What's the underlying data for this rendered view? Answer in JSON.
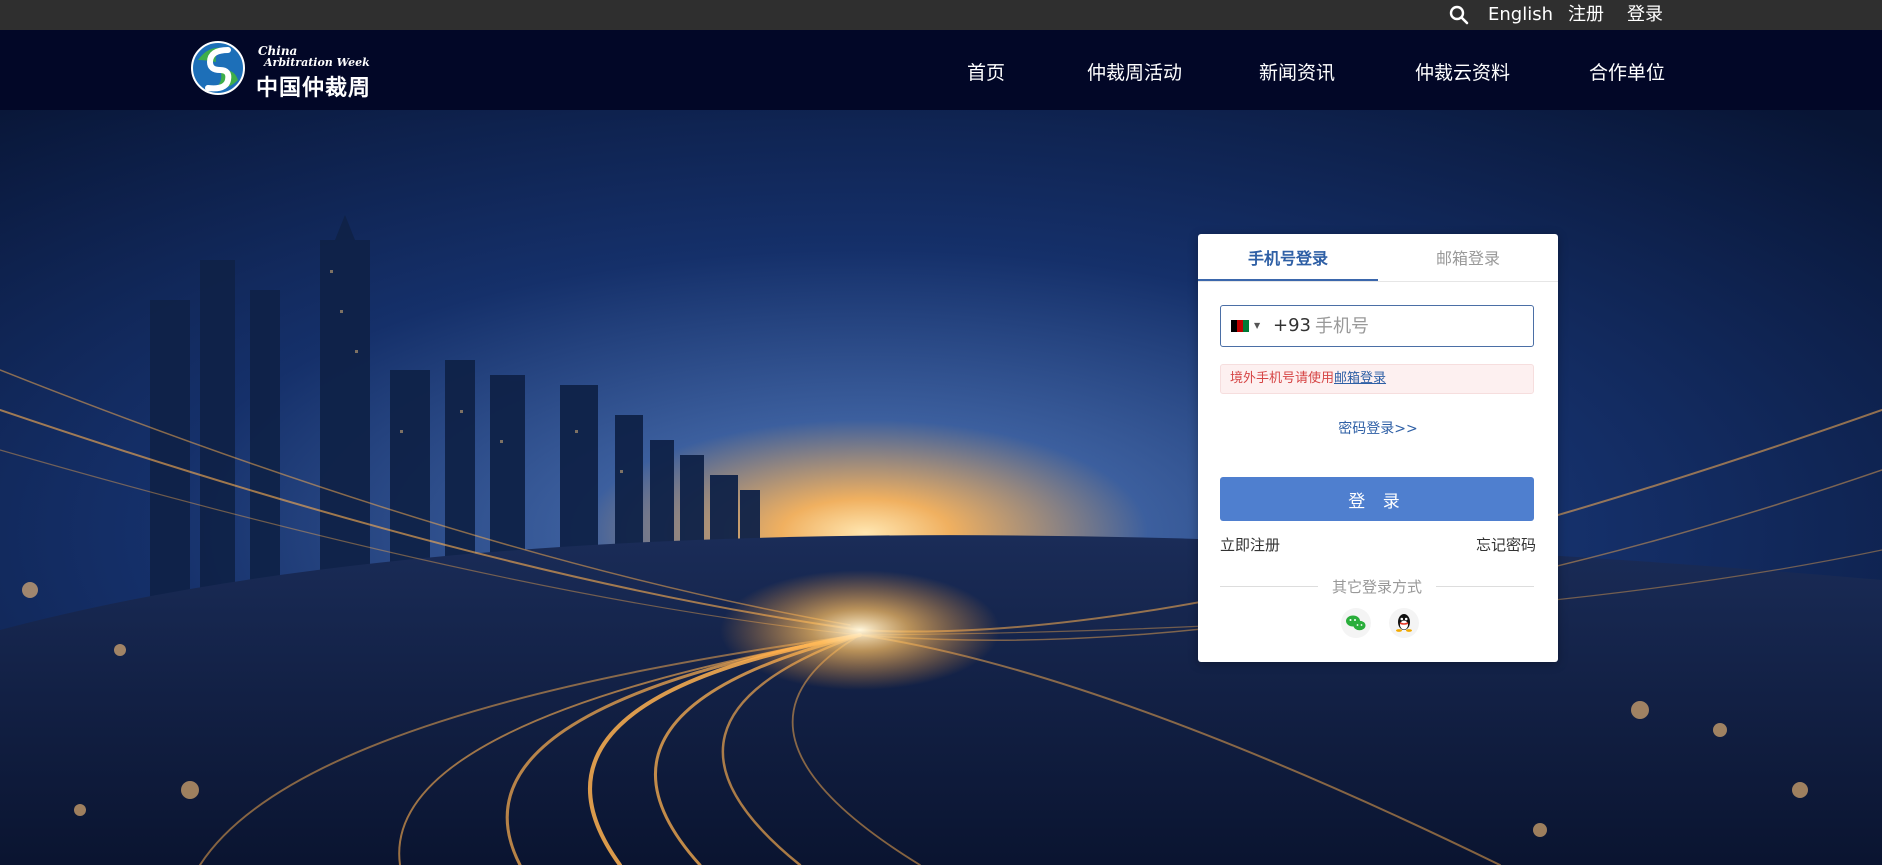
{
  "topbar": {
    "english": "English",
    "register": "注册",
    "login": "登录"
  },
  "logo": {
    "en_line1": "China",
    "en_line2": "Arbitration Week",
    "cn": "中国仲裁周"
  },
  "nav": [
    "首页",
    "仲裁周活动",
    "新闻资讯",
    "仲裁云资料",
    "合作单位"
  ],
  "login_card": {
    "tab_phone": "手机号登录",
    "tab_email": "邮箱登录",
    "dial_code": "+93",
    "phone_placeholder": "手机号",
    "notice_text": "境外手机号请使用",
    "notice_link": "邮箱登录",
    "password_login": "密码登录>>",
    "login_button": "登 录",
    "register_link": "立即注册",
    "forgot_link": "忘记密码",
    "other_methods": "其它登录方式"
  },
  "icons": [
    "search-icon",
    "afghanistan-flag-icon",
    "wechat-icon",
    "qq-icon"
  ],
  "colors": {
    "accent": "#2e5fa5",
    "button": "#4f7fcf",
    "nav_bg": "#020727",
    "topbar_bg": "#2f2f2f",
    "error": "#d64545"
  }
}
